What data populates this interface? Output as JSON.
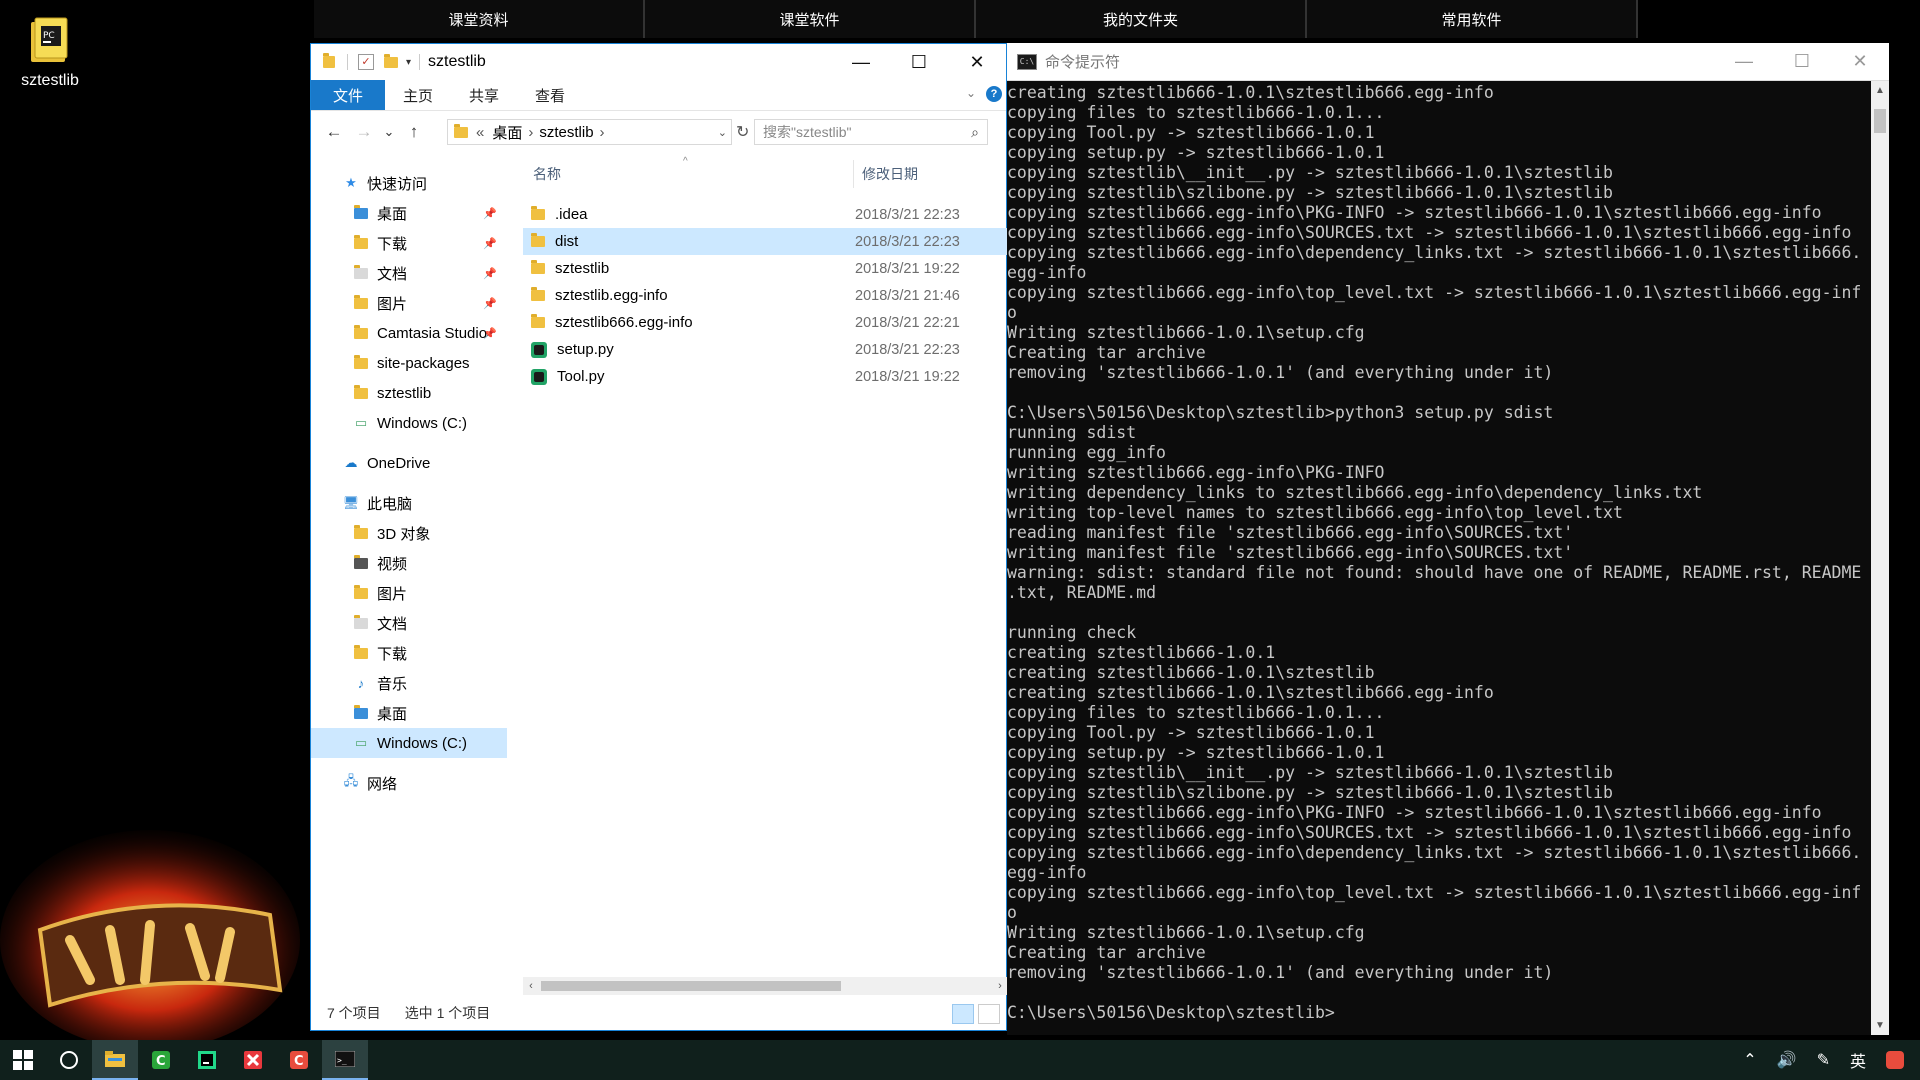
{
  "desktop": {
    "icon_label": "sztestlib"
  },
  "top_tabs": [
    "课堂资料",
    "课堂软件",
    "我的文件夹",
    "常用软件"
  ],
  "explorer": {
    "title": "sztestlib",
    "window_buttons": {
      "minimize": "—",
      "maximize": "☐",
      "close": "✕"
    },
    "ribbon_tabs": [
      "文件",
      "主页",
      "共享",
      "查看"
    ],
    "help": "?",
    "nav_arrows": {
      "back": "←",
      "forward": "→",
      "recent": "⌄",
      "up": "↑"
    },
    "address": {
      "sep0": "«",
      "crumb1": "桌面",
      "sep1": "›",
      "crumb2": "sztestlib",
      "sep2": "›"
    },
    "search_placeholder": "搜索\"sztestlib\"",
    "nav_pane": [
      {
        "label": "快速访问",
        "level": 0,
        "icon": "star-icon"
      },
      {
        "label": "桌面",
        "level": 1,
        "icon": "desktop-folder-icon",
        "pinned": true
      },
      {
        "label": "下载",
        "level": 1,
        "icon": "download-folder-icon",
        "pinned": true
      },
      {
        "label": "文档",
        "level": 1,
        "icon": "document-folder-icon",
        "pinned": true
      },
      {
        "label": "图片",
        "level": 1,
        "icon": "picture-folder-icon",
        "pinned": true
      },
      {
        "label": "Camtasia Studio",
        "level": 1,
        "icon": "folder-icon",
        "pinned": true
      },
      {
        "label": "site-packages",
        "level": 1,
        "icon": "folder-icon"
      },
      {
        "label": "sztestlib",
        "level": 1,
        "icon": "folder-icon"
      },
      {
        "label": "Windows (C:)",
        "level": 1,
        "icon": "drive-icon"
      },
      {
        "label": "OneDrive",
        "level": 0,
        "icon": "cloud-icon"
      },
      {
        "label": "此电脑",
        "level": 0,
        "icon": "computer-icon"
      },
      {
        "label": "3D 对象",
        "level": 1,
        "icon": "3d-folder-icon"
      },
      {
        "label": "视频",
        "level": 1,
        "icon": "video-folder-icon"
      },
      {
        "label": "图片",
        "level": 1,
        "icon": "picture-folder-icon"
      },
      {
        "label": "文档",
        "level": 1,
        "icon": "document-folder-icon"
      },
      {
        "label": "下载",
        "level": 1,
        "icon": "download-folder-icon"
      },
      {
        "label": "音乐",
        "level": 1,
        "icon": "music-folder-icon"
      },
      {
        "label": "桌面",
        "level": 1,
        "icon": "desktop-folder-icon"
      },
      {
        "label": "Windows (C:)",
        "level": 1,
        "icon": "drive-icon",
        "selected": true
      },
      {
        "label": "网络",
        "level": 0,
        "icon": "network-icon"
      }
    ],
    "columns": {
      "name": "名称",
      "modified": "修改日期"
    },
    "files": [
      {
        "name": ".idea",
        "date": "2018/3/21 22:23",
        "type": "folder"
      },
      {
        "name": "dist",
        "date": "2018/3/21 22:23",
        "type": "folder",
        "selected": true
      },
      {
        "name": "sztestlib",
        "date": "2018/3/21 19:22",
        "type": "folder"
      },
      {
        "name": "sztestlib.egg-info",
        "date": "2018/3/21 21:46",
        "type": "folder"
      },
      {
        "name": "sztestlib666.egg-info",
        "date": "2018/3/21 22:21",
        "type": "folder"
      },
      {
        "name": "setup.py",
        "date": "2018/3/21 22:23",
        "type": "py"
      },
      {
        "name": "Tool.py",
        "date": "2018/3/21 19:22",
        "type": "py"
      }
    ],
    "status": {
      "count": "7 个项目",
      "selected": "选中 1 个项目"
    }
  },
  "cmd": {
    "title": "命令提示符",
    "window_buttons": {
      "minimize": "—",
      "maximize": "☐",
      "close": "✕"
    },
    "lines": [
      "creating sztestlib666-1.0.1\\sztestlib666.egg-info",
      "copying files to sztestlib666-1.0.1...",
      "copying Tool.py -> sztestlib666-1.0.1",
      "copying setup.py -> sztestlib666-1.0.1",
      "copying sztestlib\\__init__.py -> sztestlib666-1.0.1\\sztestlib",
      "copying sztestlib\\szlibone.py -> sztestlib666-1.0.1\\sztestlib",
      "copying sztestlib666.egg-info\\PKG-INFO -> sztestlib666-1.0.1\\sztestlib666.egg-info",
      "copying sztestlib666.egg-info\\SOURCES.txt -> sztestlib666-1.0.1\\sztestlib666.egg-info",
      "copying sztestlib666.egg-info\\dependency_links.txt -> sztestlib666-1.0.1\\sztestlib666.",
      "egg-info",
      "copying sztestlib666.egg-info\\top_level.txt -> sztestlib666-1.0.1\\sztestlib666.egg-inf",
      "o",
      "Writing sztestlib666-1.0.1\\setup.cfg",
      "Creating tar archive",
      "removing 'sztestlib666-1.0.1' (and everything under it)",
      "",
      "C:\\Users\\50156\\Desktop\\sztestlib>python3 setup.py sdist",
      "running sdist",
      "running egg_info",
      "writing sztestlib666.egg-info\\PKG-INFO",
      "writing dependency_links to sztestlib666.egg-info\\dependency_links.txt",
      "writing top-level names to sztestlib666.egg-info\\top_level.txt",
      "reading manifest file 'sztestlib666.egg-info\\SOURCES.txt'",
      "writing manifest file 'sztestlib666.egg-info\\SOURCES.txt'",
      "warning: sdist: standard file not found: should have one of README, README.rst, README",
      ".txt, README.md",
      "",
      "running check",
      "creating sztestlib666-1.0.1",
      "creating sztestlib666-1.0.1\\sztestlib",
      "creating sztestlib666-1.0.1\\sztestlib666.egg-info",
      "copying files to sztestlib666-1.0.1...",
      "copying Tool.py -> sztestlib666-1.0.1",
      "copying setup.py -> sztestlib666-1.0.1",
      "copying sztestlib\\__init__.py -> sztestlib666-1.0.1\\sztestlib",
      "copying sztestlib\\szlibone.py -> sztestlib666-1.0.1\\sztestlib",
      "copying sztestlib666.egg-info\\PKG-INFO -> sztestlib666-1.0.1\\sztestlib666.egg-info",
      "copying sztestlib666.egg-info\\SOURCES.txt -> sztestlib666-1.0.1\\sztestlib666.egg-info",
      "copying sztestlib666.egg-info\\dependency_links.txt -> sztestlib666-1.0.1\\sztestlib666.",
      "egg-info",
      "copying sztestlib666.egg-info\\top_level.txt -> sztestlib666-1.0.1\\sztestlib666.egg-inf",
      "o",
      "Writing sztestlib666-1.0.1\\setup.cfg",
      "Creating tar archive",
      "removing 'sztestlib666-1.0.1' (and everything under it)",
      "",
      "C:\\Users\\50156\\Desktop\\sztestlib>"
    ]
  },
  "taskbar": {
    "apps": [
      "start-icon",
      "cortana-icon",
      "file-explorer-icon",
      "camtasia-icon",
      "pycharm-icon",
      "xmind-icon",
      "camtasia-recorder-icon",
      "cmd-icon"
    ],
    "tray": {
      "ime": "英"
    }
  },
  "colors": {
    "accent": "#1979ca",
    "selection": "#cce8ff",
    "console_bg": "#0c0c0c",
    "console_fg": "#c7c7c7",
    "taskbar": "#10201c"
  }
}
